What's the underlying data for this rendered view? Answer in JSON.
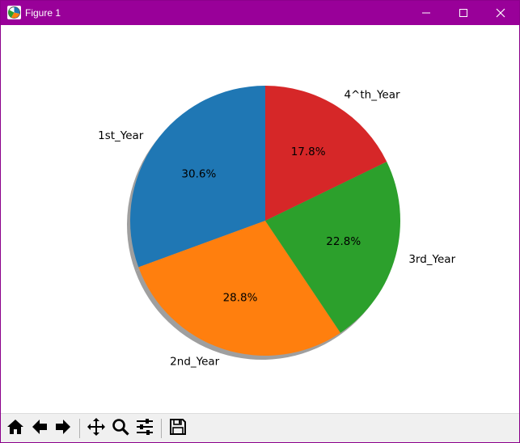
{
  "window": {
    "title": "Figure 1",
    "icons": {
      "app": "matplotlib-figure-icon",
      "minimize": "minimize-icon",
      "maximize": "maximize-icon",
      "close": "close-icon"
    }
  },
  "colors": {
    "titlebar": "#990099",
    "blue": "#1f77b4",
    "orange": "#ff7f0e",
    "green": "#2ca02c",
    "red": "#d62728"
  },
  "toolbar": {
    "buttons": [
      {
        "name": "home-icon"
      },
      {
        "name": "back-arrow-icon"
      },
      {
        "name": "forward-arrow-icon"
      },
      {
        "name": "pan-move-icon"
      },
      {
        "name": "zoom-magnifier-icon"
      },
      {
        "name": "configure-subplots-icon"
      },
      {
        "name": "save-floppy-icon"
      }
    ]
  },
  "chart_data": {
    "type": "pie",
    "title": "",
    "start_angle_deg": 90,
    "counterclock": true,
    "shadow": true,
    "slices": [
      {
        "label": "1st_Year",
        "percent": 30.6,
        "pct_label": "30.6%",
        "color": "#1f77b4"
      },
      {
        "label": "2nd_Year",
        "percent": 28.8,
        "pct_label": "28.8%",
        "color": "#ff7f0e"
      },
      {
        "label": "3rd_Year",
        "percent": 22.8,
        "pct_label": "22.8%",
        "color": "#2ca02c"
      },
      {
        "label": "4^th_Year",
        "percent": 17.8,
        "pct_label": "17.8%",
        "color": "#d62728"
      }
    ]
  }
}
